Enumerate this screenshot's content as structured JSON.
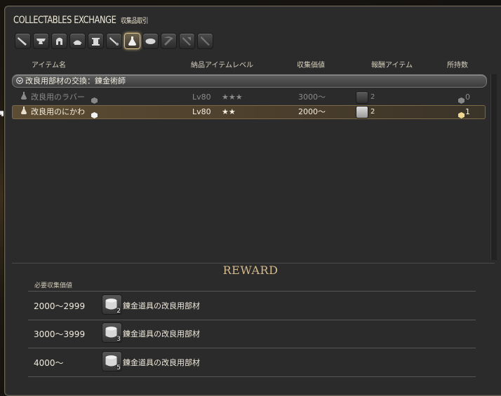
{
  "window": {
    "title": "COLLECTABLES EXCHANGE",
    "title_jp": "収集品取引"
  },
  "categories": [
    {
      "icon": "pen-icon"
    },
    {
      "icon": "anvil-icon"
    },
    {
      "icon": "helmet-icon"
    },
    {
      "icon": "crown-icon"
    },
    {
      "icon": "loom-icon"
    },
    {
      "icon": "knife-icon"
    },
    {
      "icon": "alchemy-flask-icon",
      "active": true
    },
    {
      "icon": "cooking-pot-icon"
    },
    {
      "icon": "pickaxe-icon",
      "dim": true
    },
    {
      "icon": "hatchet-icon",
      "dim": true
    },
    {
      "icon": "fishing-rod-icon",
      "dim": true
    }
  ],
  "headers": {
    "item_name": "アイテム名",
    "item_level": "納品アイテムレベル",
    "collectability": "収集価値",
    "reward_item": "報酬アイテム",
    "owned": "所持数"
  },
  "group": {
    "label": "改良用部材の交換：錬金術師"
  },
  "items": [
    {
      "name": "改良用のラバー",
      "level": "Lv80",
      "stars": "★★★",
      "collectability": "3000〜",
      "reward_count": "2",
      "owned": "0"
    },
    {
      "name": "改良用のにかわ",
      "level": "Lv80",
      "stars": "★★",
      "collectability": "2000〜",
      "reward_count": "2",
      "owned": "1"
    }
  ],
  "reward": {
    "title": "REWARD",
    "subtitle": "必要収集価値",
    "rows": [
      {
        "range": "2000〜2999",
        "count": "2",
        "name": "錬金道具の改良用部材"
      },
      {
        "range": "3000〜3999",
        "count": "3",
        "name": "錬金道具の改良用部材"
      },
      {
        "range": "4000〜",
        "count": "5",
        "name": "錬金道具の改良用部材"
      }
    ]
  },
  "colors": {
    "accent_gold": "#d4b98a",
    "selected_row": "#5c4c33"
  }
}
